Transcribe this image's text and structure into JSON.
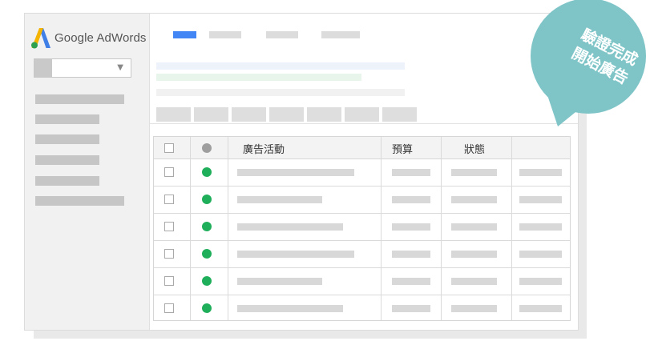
{
  "app": {
    "logo_text": "Google AdWords"
  },
  "campaign_table": {
    "headers": {
      "campaign": "廣告活動",
      "budget": "預算",
      "status": "狀態"
    },
    "status_colors": {
      "header_dot": "#9e9e9e",
      "enabled": "#1fae5a"
    },
    "row_count": 6
  },
  "callout": {
    "line1": "驗證完成",
    "line2": "開始廣告",
    "color": "#7fc5c8"
  },
  "colors": {
    "active_tab": "#4285f4",
    "logo_blue": "#3f7fe6",
    "logo_yellow": "#f4b400",
    "logo_green": "#2fa050"
  }
}
